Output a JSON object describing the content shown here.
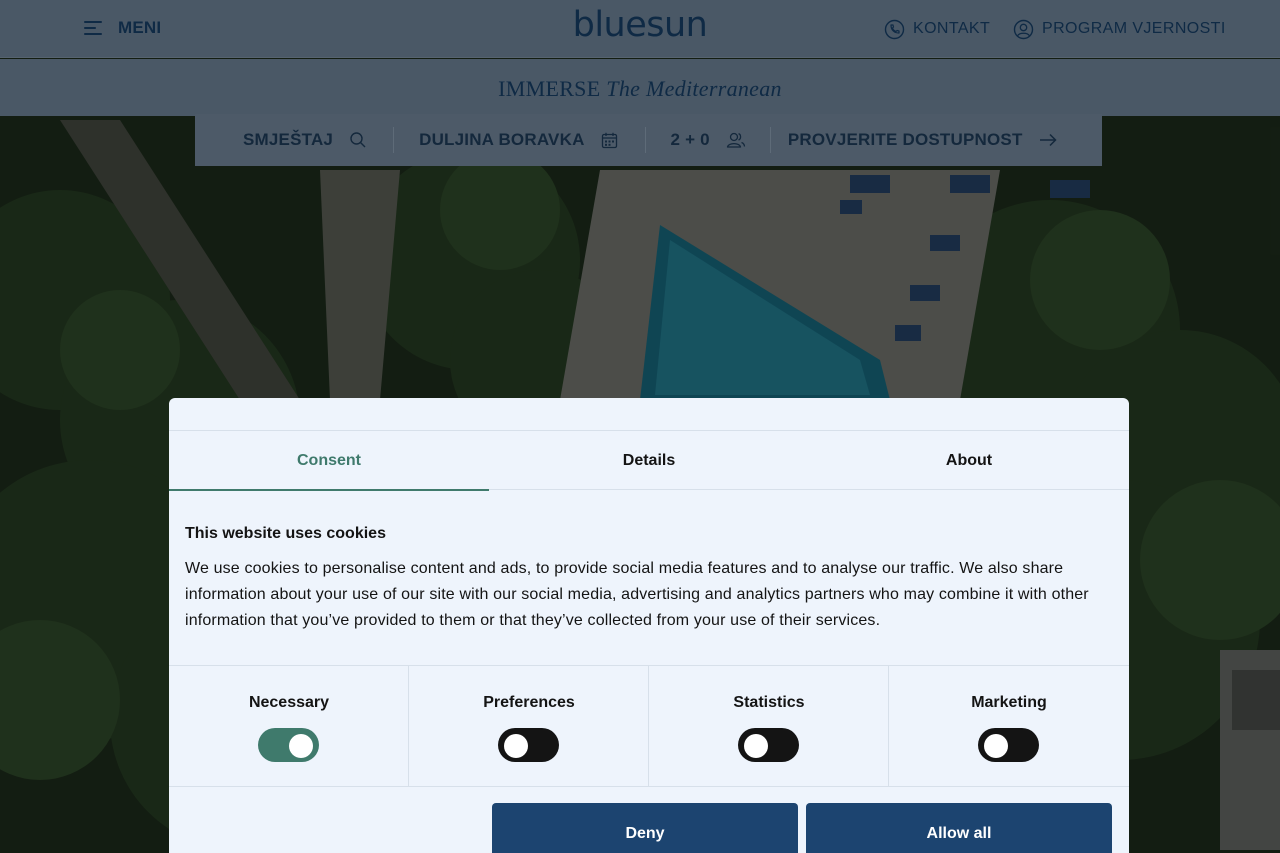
{
  "header": {
    "menu_label": "MENI",
    "logo_text": "bluesun",
    "contact_label": "KONTAKT",
    "loyalty_label": "PROGRAM VJERNOSTI"
  },
  "tagline": {
    "prefix": "IMMERSE",
    "italic": "The Mediterranean"
  },
  "booking": {
    "accommodation_label": "SMJEŠTAJ",
    "stay_length_label": "DULJINA BORAVKA",
    "guests_label": "2 + 0",
    "check_availability_label": "PROVJERITE DOSTUPNOST"
  },
  "cookie_dialog": {
    "tabs": [
      {
        "label": "Consent",
        "active": true
      },
      {
        "label": "Details",
        "active": false
      },
      {
        "label": "About",
        "active": false
      }
    ],
    "title": "This website uses cookies",
    "body": "We use cookies to personalise content and ads, to provide social media features and to analyse our traffic. We also share information about your use of our site with our social media, advertising and analytics partners who may combine it with other information that you’ve provided to them or that they’ve collected from your use of their services.",
    "categories": [
      {
        "label": "Necessary",
        "enabled": true
      },
      {
        "label": "Preferences",
        "enabled": false
      },
      {
        "label": "Statistics",
        "enabled": false
      },
      {
        "label": "Marketing",
        "enabled": false
      }
    ],
    "deny_label": "Deny",
    "allow_all_label": "Allow all"
  },
  "icons": {
    "menu": "menu-icon",
    "contact": "phone-icon",
    "loyalty": "user-circle-icon",
    "accommodation": "search-icon",
    "stay_length": "calendar-icon",
    "guests": "users-icon",
    "check_availability": "arrow-right-icon"
  },
  "colors": {
    "brand_navy": "#0f2a45",
    "accent_green": "#3f7a6c",
    "button_blue": "#1c4470",
    "dialog_bg": "#eef4fc"
  }
}
